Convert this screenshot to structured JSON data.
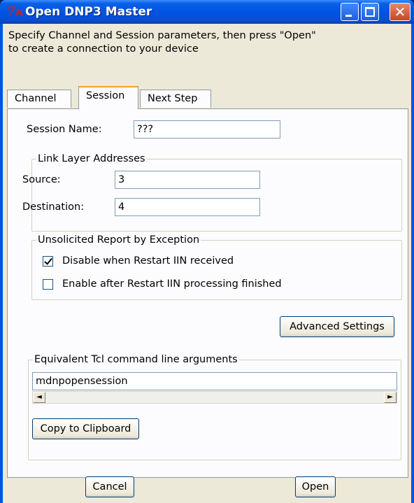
{
  "window": {
    "title": "Open DNP3 Master",
    "icon_glyph": "7ĸ",
    "minimize_icon": "minimize-icon",
    "maximize_icon": "maximize-icon",
    "close_glyph": "✕"
  },
  "instructions": "Specify Channel and Session parameters, then press \"Open\"\nto create a connection to your device",
  "tabs": [
    {
      "label": "Channel",
      "selected": false
    },
    {
      "label": "Session",
      "selected": true
    },
    {
      "label": "Next Step",
      "selected": false
    }
  ],
  "session": {
    "name_label": "Session Name:",
    "name_value": "???"
  },
  "link_layer": {
    "title": "Link Layer Addresses",
    "source_label": "Source:",
    "source_value": "3",
    "destination_label": "Destination:",
    "destination_value": "4"
  },
  "unsolicited": {
    "title": "Unsolicited Report by Exception",
    "disable_label": "Disable when Restart IIN received",
    "disable_checked": true,
    "enable_label": "Enable after Restart IIN processing finished",
    "enable_checked": false
  },
  "advanced_button": "Advanced Settings",
  "tcl": {
    "title": "Equivalent Tcl command line arguments",
    "value": "mdnpopensession",
    "copy_button": "Copy to Clipboard",
    "left_arrow": "◄",
    "right_arrow": "►"
  },
  "buttons": {
    "cancel": "Cancel",
    "open": "Open"
  },
  "colors": {
    "titlebar": "#0054e3",
    "dialog_bg": "#ece9d8",
    "tab_highlight": "#f1a126",
    "close_button": "#c8452a"
  }
}
